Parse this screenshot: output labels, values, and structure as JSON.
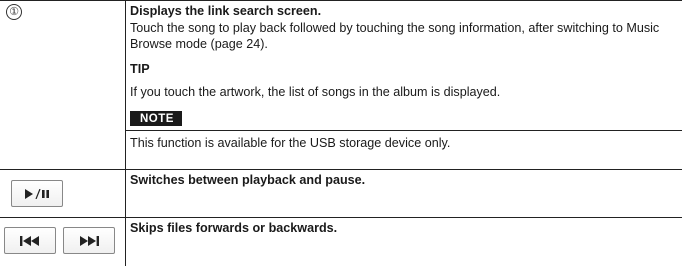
{
  "rows": [
    {
      "marker": "①",
      "heading": "Displays the link search screen.",
      "body": "Touch the song to play back followed by touching the song information, after switching to Music Browse mode (page 24).",
      "tip_label": "TIP",
      "tip_text": "If you touch the artwork, the list of songs in the album is displayed.",
      "note_label": "NOTE",
      "note_text": "This function is available for the USB storage device only."
    },
    {
      "icon": "play-pause-icon",
      "heading": "Switches between playback and pause."
    },
    {
      "icons": [
        "previous-track-icon",
        "next-track-icon"
      ],
      "heading": "Skips files forwards or backwards."
    }
  ],
  "colors": {
    "rule": "#222222",
    "note_badge_bg": "#1a1a1a",
    "note_badge_text": "#ffffff"
  }
}
